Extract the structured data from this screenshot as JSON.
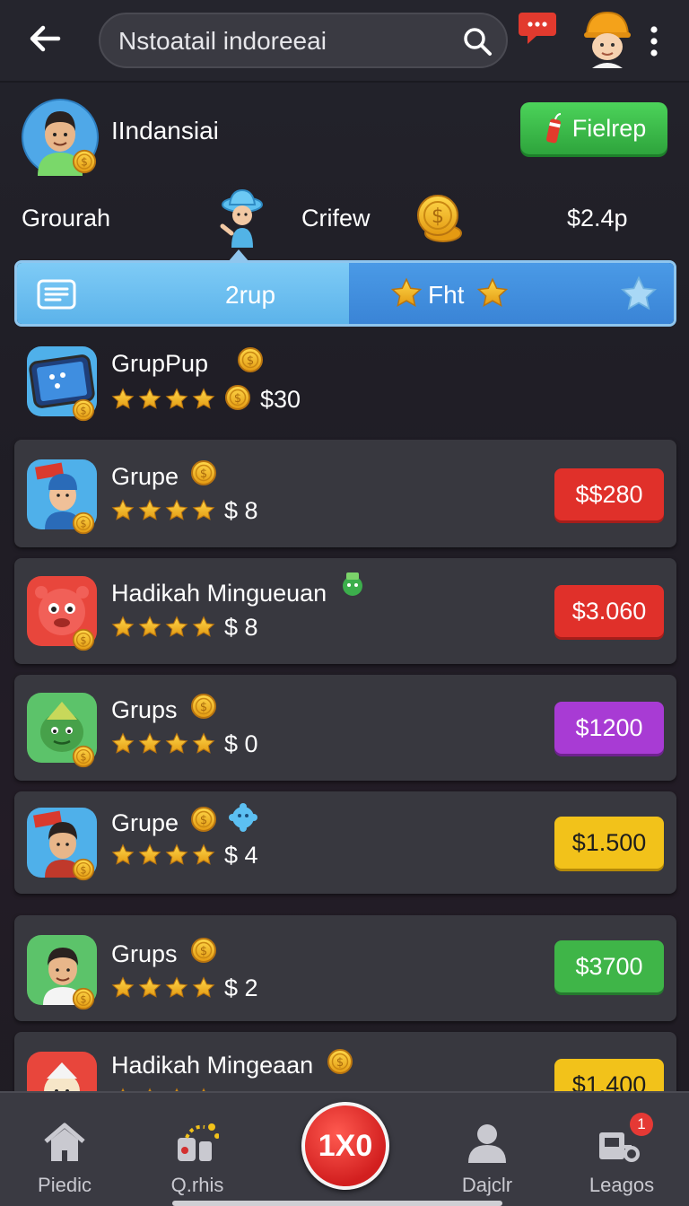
{
  "header": {
    "search_text": "Nstoatail indoreeai"
  },
  "profile": {
    "name": "IIndansiai",
    "button_label": "Fielrep"
  },
  "stats": {
    "left": "Grourah",
    "mid": "Crifew",
    "right": "$2.4p"
  },
  "tabs": [
    {
      "label": "2rup"
    },
    {
      "label": "Fht"
    }
  ],
  "items": [
    {
      "title": "GrupPup",
      "sub": "$30",
      "price": null
    },
    {
      "title": "Grupe",
      "sub": "$ 8",
      "price": "$$280",
      "price_color": "#e0302a"
    },
    {
      "title": "Hadikah Mingueuan",
      "sub": "$ 8",
      "price": "$3.060",
      "price_color": "#e0302a"
    },
    {
      "title": "Grups",
      "sub": "$ 0",
      "price": "$1200",
      "price_color": "#a83bd4"
    },
    {
      "title": "Grupe",
      "sub": "$ 4",
      "price": "$1.500",
      "price_color": "#f2c21a"
    },
    {
      "title": "Grups",
      "sub": "$ 2",
      "price": "$3700",
      "price_color": "#3fb548"
    },
    {
      "title": "Hadikah Mingeaan",
      "sub": "",
      "price": "$1.400",
      "price_color": "#f2c21a"
    }
  ],
  "nav": {
    "items": [
      {
        "label": "Piedic",
        "icon": "home-icon"
      },
      {
        "label": "Q.rhis",
        "icon": "tools-icon"
      },
      {
        "label": "Dajclr",
        "icon": "person-icon"
      },
      {
        "label": "Leagos",
        "icon": "machine-icon"
      }
    ],
    "center_label": "1X0",
    "badge": "1"
  },
  "colors": {
    "accent_green": "#3fb548",
    "accent_blue": "#4a9ae6",
    "price_red": "#e0302a",
    "price_purple": "#a83bd4",
    "price_yellow": "#f2c21a"
  }
}
